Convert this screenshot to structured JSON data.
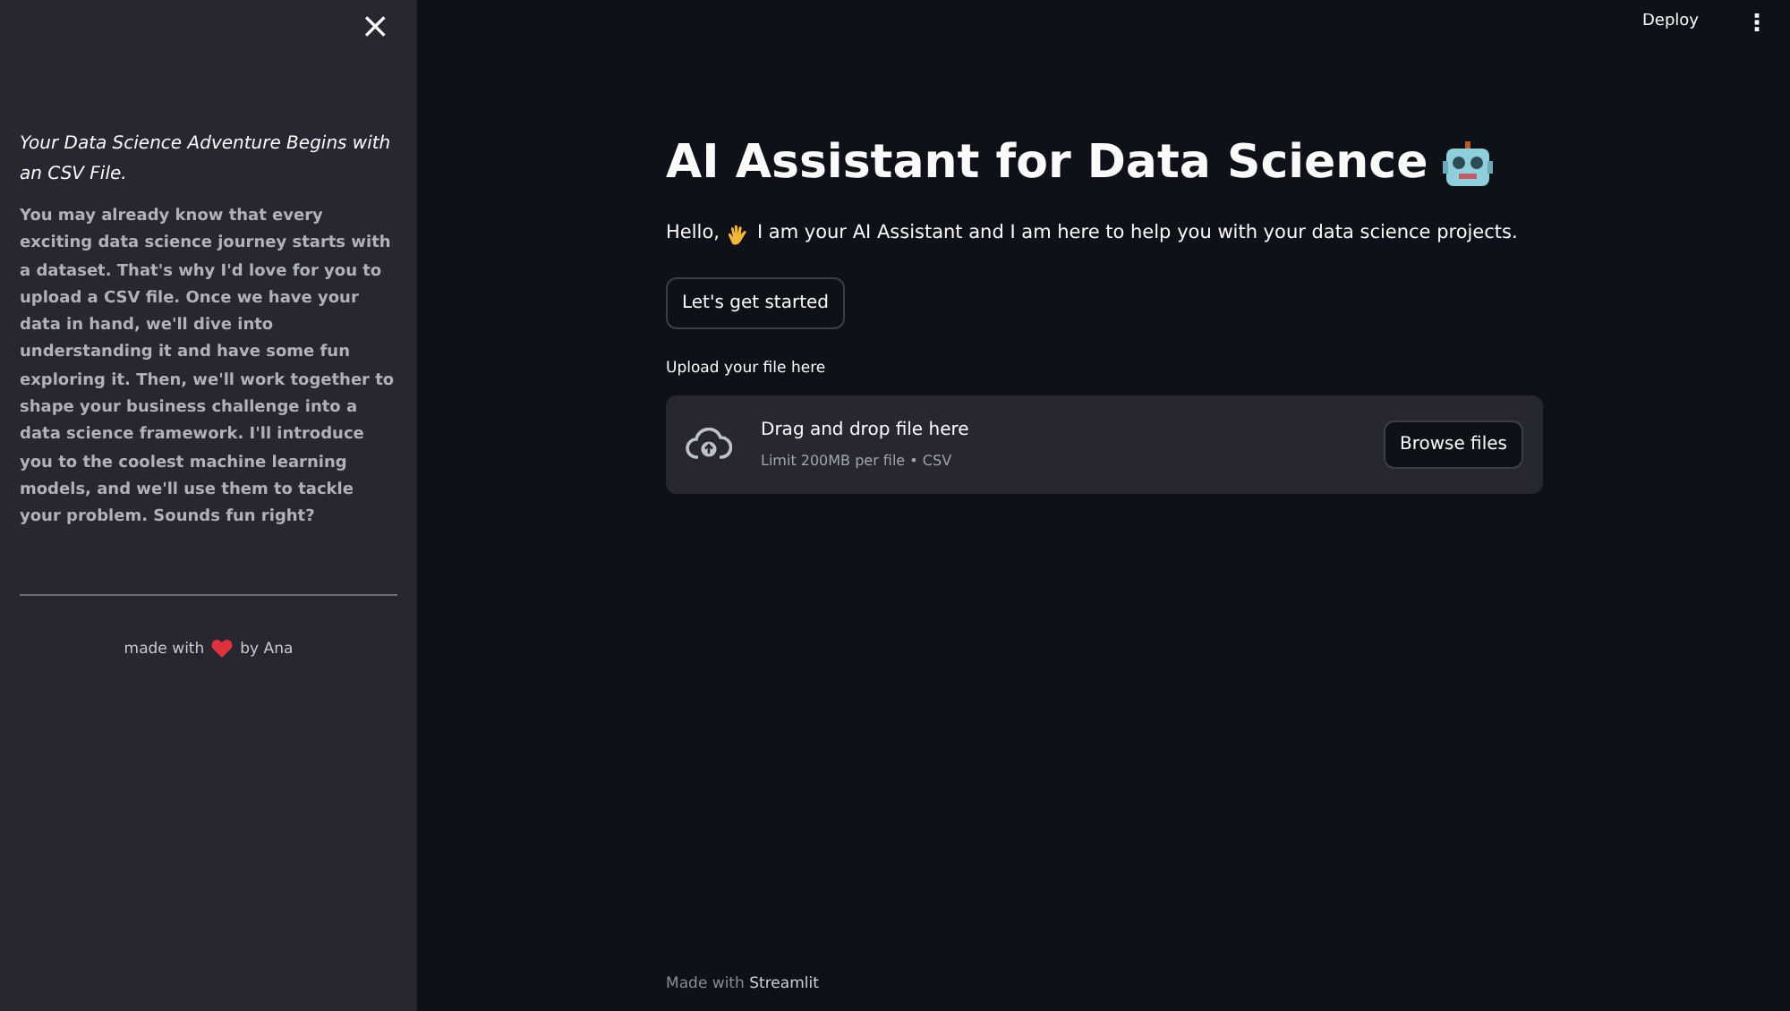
{
  "sidebar": {
    "close": "×",
    "heading": "Your Data Science Adventure Begins with an CSV File.",
    "body": "You may already know that every exciting data science journey starts with a dataset. That's why I'd love for you to upload a CSV file. Once we have your data in hand, we'll dive into understanding it and have some fun exploring it. Then, we'll work together to shape your business challenge into a data science framework. I'll introduce you to the coolest machine learning models, and we'll use them to tackle your problem. Sounds fun right?",
    "footer_before": "made with",
    "footer_after": "by Ana"
  },
  "header": {
    "deploy": "Deploy",
    "menu": "⋮"
  },
  "title": "AI Assistant for Data Science",
  "greeting_before": "Hello,",
  "greeting_after": "I am your AI Assistant and I am here to help you with your data science projects.",
  "start_button": "Let's get started",
  "uploader": {
    "label": "Upload your file here",
    "drop_text": "Drag and drop file here",
    "limit": "Limit 200MB per file • CSV",
    "browse": "Browse files"
  },
  "footer": {
    "prefix": "Made with",
    "brand": "Streamlit"
  }
}
